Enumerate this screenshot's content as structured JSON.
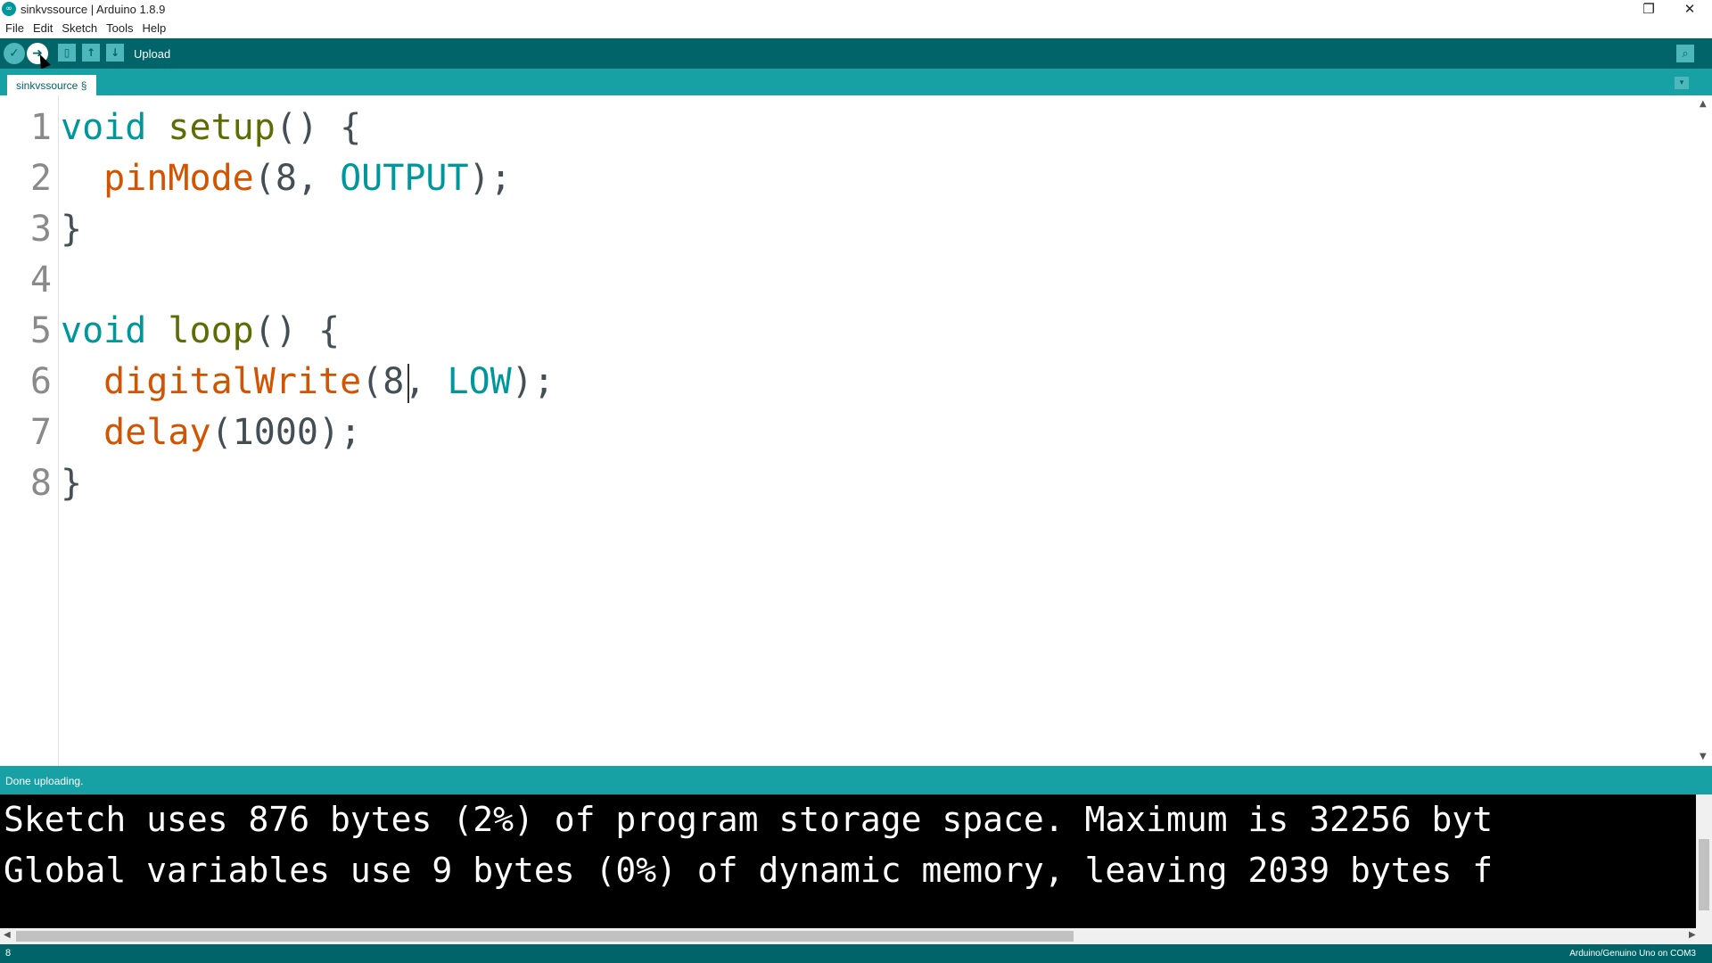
{
  "window": {
    "title": "sinkvssource | Arduino 1.8.9",
    "logo_glyph": "∞",
    "restore_glyph": "❐",
    "close_glyph": "✕"
  },
  "menu": [
    "File",
    "Edit",
    "Sketch",
    "Tools",
    "Help"
  ],
  "toolbar": {
    "verify_glyph": "✓",
    "upload_glyph": "➜",
    "new_glyph": "▯",
    "open_glyph": "↑",
    "save_glyph": "↓",
    "serial_glyph": "⌕",
    "hint": "Upload"
  },
  "tabs": {
    "active": "sinkvssource §",
    "menu_glyph": "▾"
  },
  "editor": {
    "line_numbers": [
      "1",
      "2",
      "3",
      "4",
      "5",
      "6",
      "7",
      "8"
    ],
    "lines": [
      [
        {
          "t": "void",
          "c": "kw-type"
        },
        {
          "t": " ",
          "c": "plain"
        },
        {
          "t": "setup",
          "c": "kw-func-setup"
        },
        {
          "t": "() {",
          "c": "plain"
        }
      ],
      [
        {
          "t": "  ",
          "c": "plain"
        },
        {
          "t": "pinMode",
          "c": "kw-func"
        },
        {
          "t": "(8, ",
          "c": "plain"
        },
        {
          "t": "OUTPUT",
          "c": "kw-const"
        },
        {
          "t": ");",
          "c": "plain"
        }
      ],
      [
        {
          "t": "}",
          "c": "plain"
        }
      ],
      [],
      [
        {
          "t": "void",
          "c": "kw-type"
        },
        {
          "t": " ",
          "c": "plain"
        },
        {
          "t": "loop",
          "c": "kw-func-setup"
        },
        {
          "t": "() {",
          "c": "plain"
        }
      ],
      [
        {
          "t": "  ",
          "c": "plain"
        },
        {
          "t": "digitalWrite",
          "c": "kw-func"
        },
        {
          "t": "(8, ",
          "c": "plain"
        },
        {
          "t": "LOW",
          "c": "kw-const"
        },
        {
          "t": ");",
          "c": "plain"
        }
      ],
      [
        {
          "t": "  ",
          "c": "plain"
        },
        {
          "t": "delay",
          "c": "kw-func"
        },
        {
          "t": "(1000);",
          "c": "plain"
        }
      ],
      [
        {
          "t": "}",
          "c": "plain"
        }
      ]
    ],
    "scroll_up_glyph": "▲",
    "scroll_down_glyph": "▼"
  },
  "status": {
    "message": "Done uploading."
  },
  "console": {
    "lines": [
      "Sketch uses 876 bytes (2%) of program storage space. Maximum is 32256 byt",
      "Global variables use 9 bytes (0%) of dynamic memory, leaving 2039 bytes f"
    ],
    "left_glyph": "◀",
    "right_glyph": "▶"
  },
  "footer": {
    "line": "8",
    "board": "Arduino/Genuino Uno on COM3"
  }
}
